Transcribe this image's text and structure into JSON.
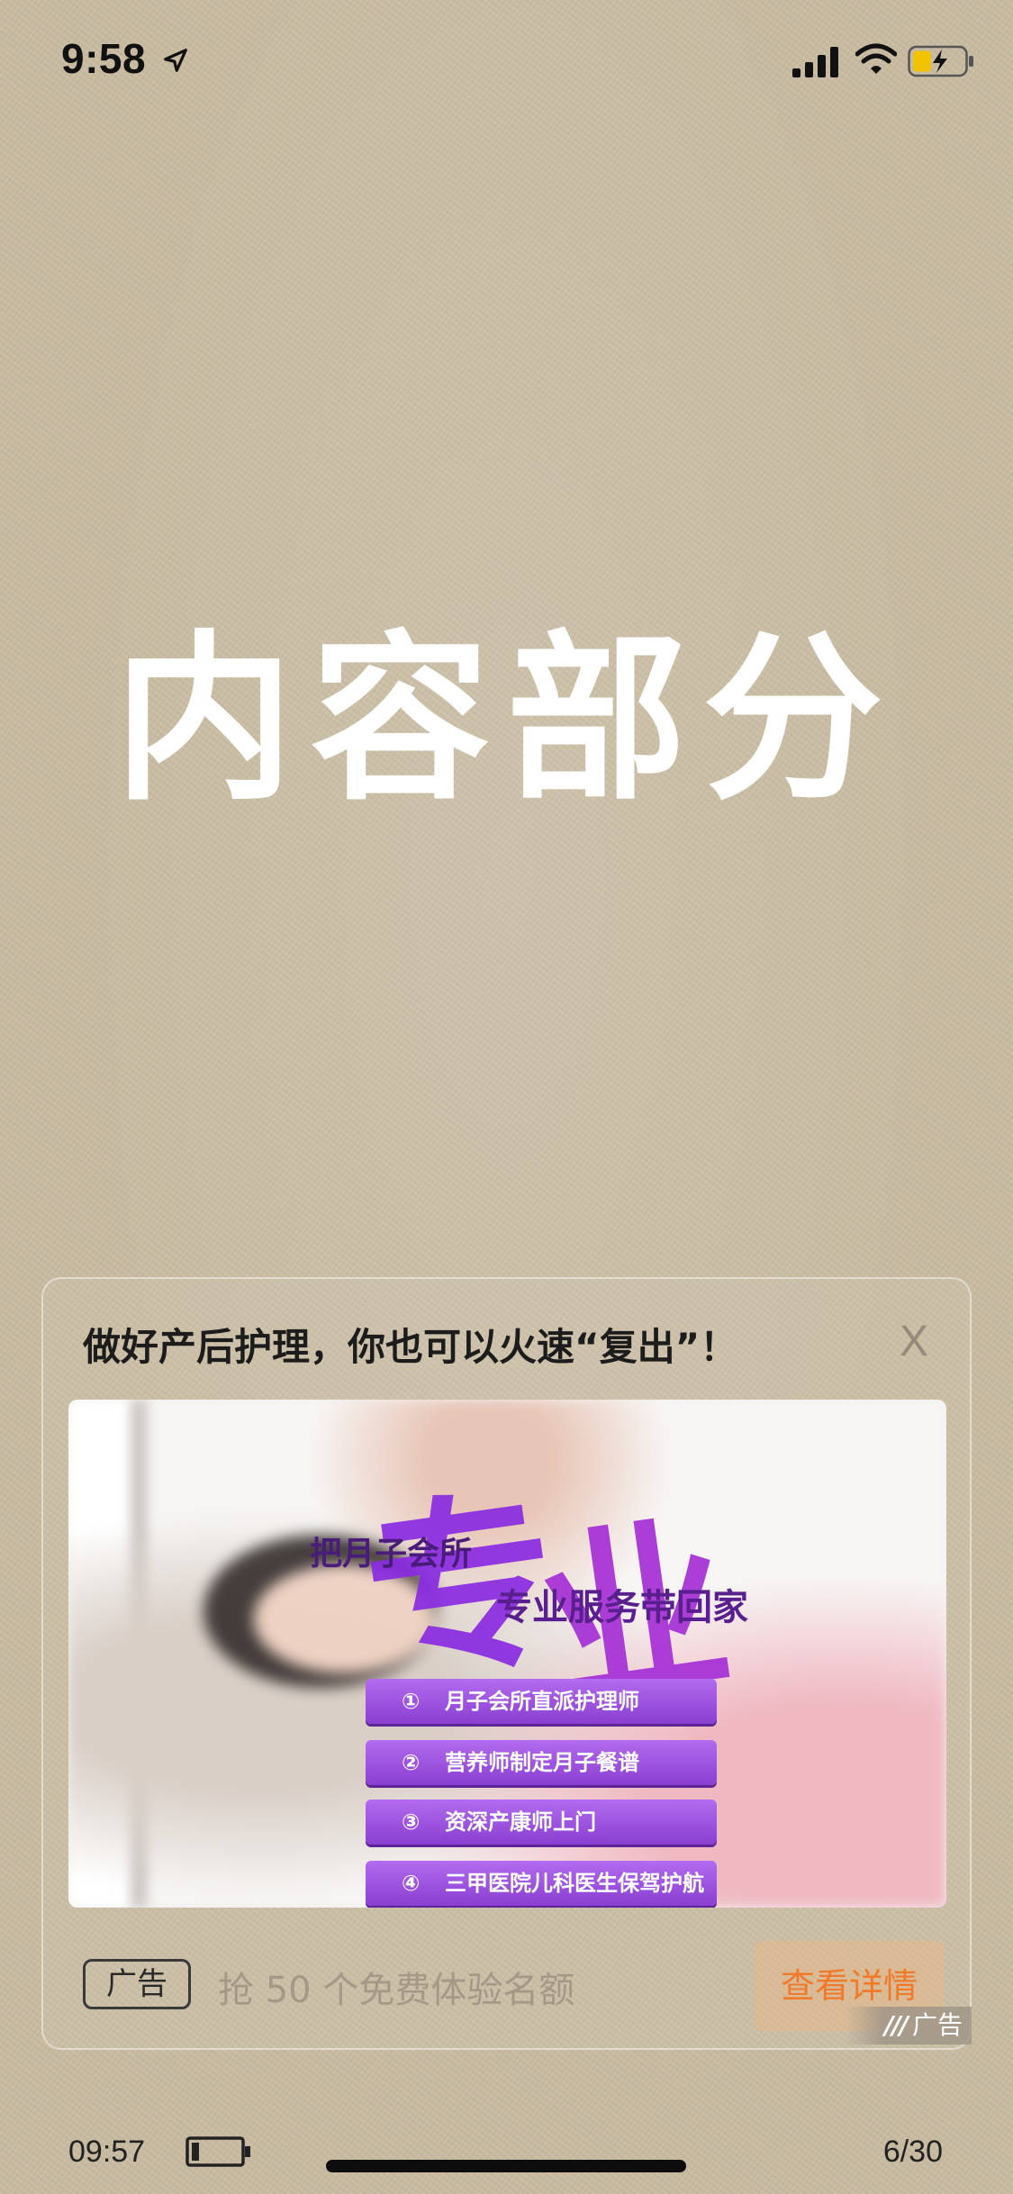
{
  "status_bar": {
    "time": "9:58",
    "icons": [
      "location-arrow-icon",
      "cellular-signal-icon",
      "wifi-icon",
      "battery-charging-icon"
    ]
  },
  "content": {
    "title": "内容部分"
  },
  "ad": {
    "headline": "做好产后护理，你也可以火速“复出”！",
    "close_label": "X",
    "image": {
      "big_chars": [
        "专",
        "业"
      ],
      "tagline_1": "把月子会所",
      "tagline_2": "专业服务带回家",
      "features": [
        {
          "num": "①",
          "text": "月子会所直派护理师"
        },
        {
          "num": "②",
          "text": "营养师制定月子餐谱"
        },
        {
          "num": "③",
          "text": "资深产康师上门"
        },
        {
          "num": "④",
          "text": "三甲医院儿科医生保驾护航"
        }
      ]
    },
    "ad_label": "广告",
    "subtext": "抢 50 个免费体验名额",
    "cta_label": "查看详情",
    "source_label": "广告"
  },
  "bottom_bar": {
    "time": "09:57",
    "page": "6/30"
  },
  "colors": {
    "background": "#c9bca2",
    "cta_text": "#f07a2a",
    "ribbon": "#8a3fd0"
  }
}
